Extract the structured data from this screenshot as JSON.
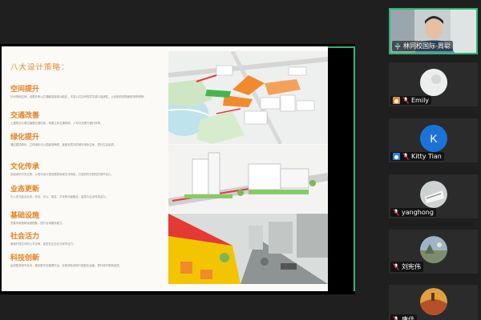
{
  "slide": {
    "title": "八大设计策略：",
    "strategies": [
      {
        "heading": "空间提升",
        "desc": "针对场地空间，设置多条公共通廊连接各功能区，丰富公共空间的层次感与连续性，以全新的视角营造场所精神。"
      },
      {
        "heading": "交通改善",
        "desc": "上盖物业与周边道路无缝衔接，构建立体交通网络，人车分流提升通行效率。"
      },
      {
        "heading": "绿化提升",
        "desc": "通过屋顶绿化、立体绿化与公园景观串联，营造多层次的城市绿色空间，提升生态品质。"
      },
      {
        "heading": "文化传承",
        "desc": "延续城市历史文脉，以现代设计语言展现地域文化特色，打造具有识别性的城市名片。"
      },
      {
        "heading": "业态更新",
        "desc": "引入多元复合业态，商业、办公、居住、文化等功能融合，激发片区全时段活力。"
      },
      {
        "heading": "基础设施",
        "desc": "完善市政基础设施配套，提升区域服务能力。"
      },
      {
        "heading": "社会活力",
        "desc": "营造开放共享的公共空间，促进社区交往与城市活力。"
      },
      {
        "heading": "科技创新",
        "desc": "运用智慧城市技术，建设数字化管理平台，实现绿色低碳与智能化运营，提升城市更新品质。"
      }
    ]
  },
  "participants": [
    {
      "name": "林同校国际-周聪",
      "type": "video",
      "muted": false
    },
    {
      "name": "Emily",
      "type": "photo",
      "muted": true
    },
    {
      "name": "Kitty Tian",
      "type": "letter",
      "letter": "K",
      "muted": true
    },
    {
      "name": "yanghong",
      "type": "photo",
      "muted": true
    },
    {
      "name": "刘宪伟",
      "type": "photo",
      "muted": true
    },
    {
      "name": "唐佳",
      "type": "photo",
      "muted": true
    }
  ],
  "colors": {
    "accent": "#2bb673",
    "heading": "#e8821e",
    "kitty_avatar": "#1a73d9"
  }
}
